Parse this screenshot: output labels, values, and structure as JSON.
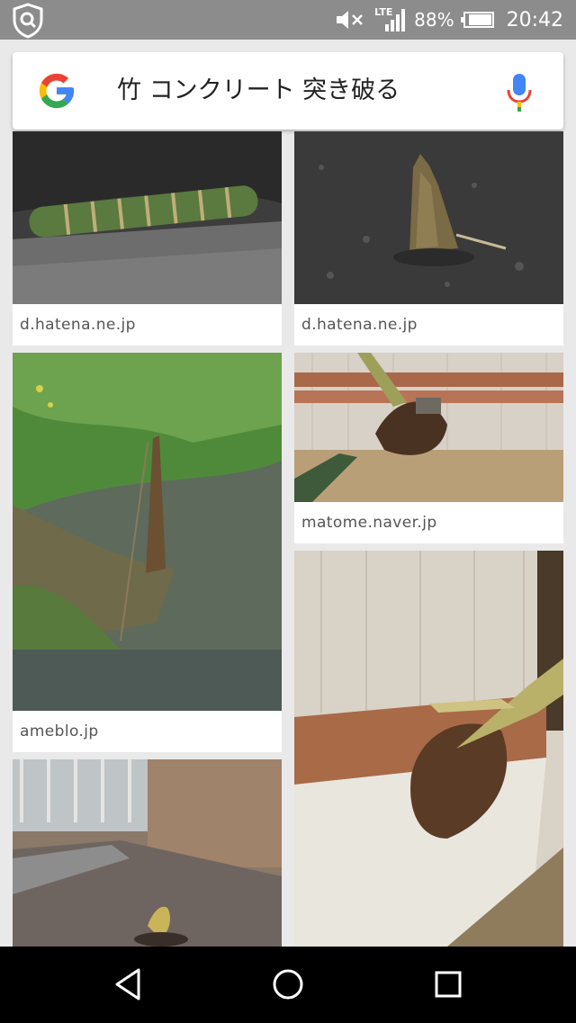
{
  "status_bar": {
    "network": "LTE",
    "battery_percent": "88%",
    "battery_level": 0.88,
    "time": "20:42",
    "icons": [
      "shield-search-icon",
      "mute-icon",
      "signal-icon",
      "battery-icon"
    ]
  },
  "search": {
    "query": "竹 コンクリート 突き破る",
    "logo": "google-g-logo",
    "mic": "microphone-icon"
  },
  "results": [
    {
      "source": "d.hatena.ne.jp",
      "image": "bamboo shoot lying in cracked asphalt"
    },
    {
      "source": "d.hatena.ne.jp",
      "image": "bamboo shoot emerging through asphalt"
    },
    {
      "source": "ameblo.jp",
      "image": "thin bamboo shoot in grass and dirt"
    },
    {
      "source": "matome.naver.jp",
      "image": "bamboo shoot growing through indoor wall"
    },
    {
      "source": "",
      "image": "bamboo shoot breaking through wall above tatami"
    },
    {
      "source": "",
      "image": "small shoot near wooden boards"
    }
  ],
  "nav": [
    "back-icon",
    "home-icon",
    "recents-icon"
  ],
  "colors": {
    "status_bar": "#8c8c8c",
    "background": "#e9e9e9",
    "google_blue": "#4285f4",
    "google_red": "#ea4335",
    "google_yellow": "#fbbc05",
    "google_green": "#34a853"
  }
}
